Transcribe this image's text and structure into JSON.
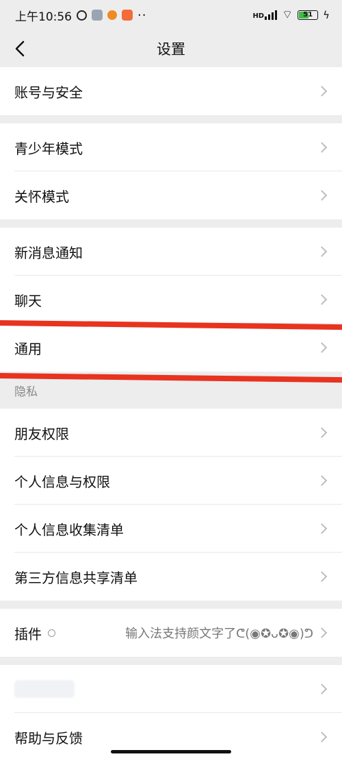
{
  "status_bar": {
    "time": "上午10:56",
    "network": "HD",
    "battery": "51"
  },
  "header": {
    "title": "设置"
  },
  "groups": {
    "account": {
      "label": "账号与安全"
    },
    "youth": {
      "label": "青少年模式"
    },
    "care": {
      "label": "关怀模式"
    },
    "notifications": {
      "label": "新消息通知"
    },
    "chat": {
      "label": "聊天"
    },
    "general": {
      "label": "通用"
    },
    "privacy_section": "隐私",
    "friend_permissions": {
      "label": "朋友权限"
    },
    "personal_info_permissions": {
      "label": "个人信息与权限"
    },
    "personal_info_collection": {
      "label": "个人信息收集清单"
    },
    "third_party_sharing": {
      "label": "第三方信息共享清单"
    },
    "plugins": {
      "label": "插件",
      "value": "输入法支持颜文字了ᕦ(◉✪ᴗ✪◉)ᕤ"
    },
    "help_feedback": {
      "label": "帮助与反馈"
    }
  },
  "annotations": {
    "red_mark_color": "#e8331f"
  }
}
